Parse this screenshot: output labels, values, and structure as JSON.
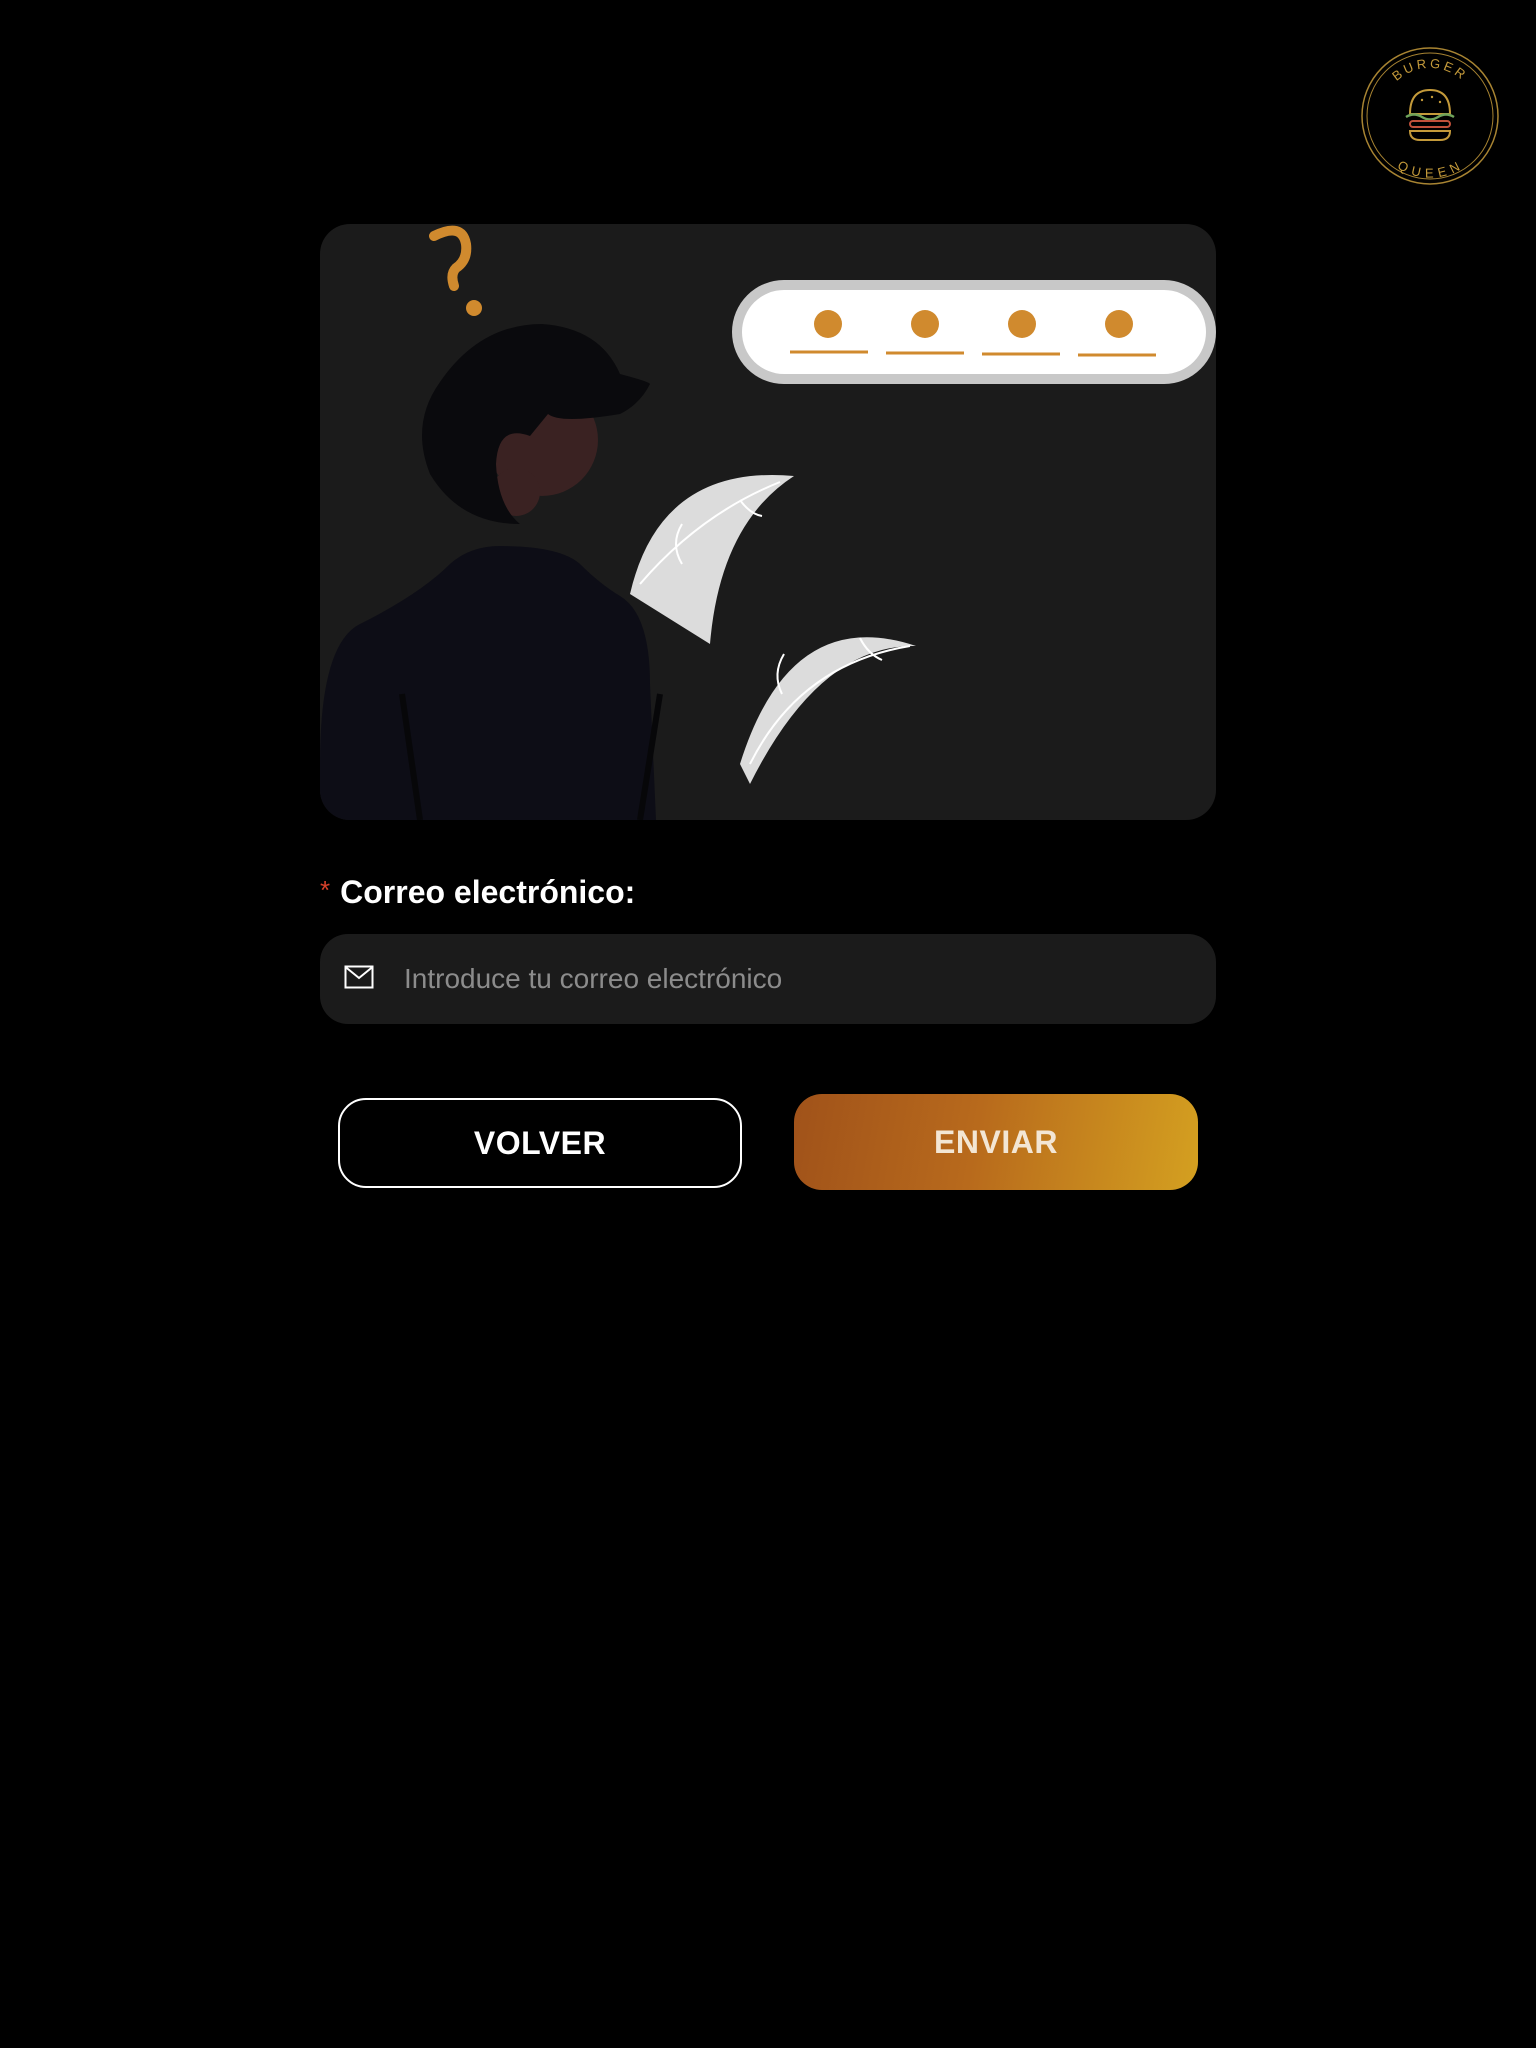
{
  "logo": {
    "top_text": "BURGER",
    "bottom_text": "QUEEN"
  },
  "hero": {
    "question_mark": "?"
  },
  "form": {
    "email_label": "Correo electrónico:",
    "required_mark": "*",
    "email_placeholder": "Introduce tu correo electrónico",
    "email_value": ""
  },
  "buttons": {
    "back_label": "VOLVER",
    "send_label": "ENVIAR"
  },
  "colors": {
    "background": "#000000",
    "card": "#1b1b1b",
    "accent_gold": "#d08a2e",
    "required_red": "#d6402a"
  },
  "icons": {
    "email": "envelope-icon"
  }
}
